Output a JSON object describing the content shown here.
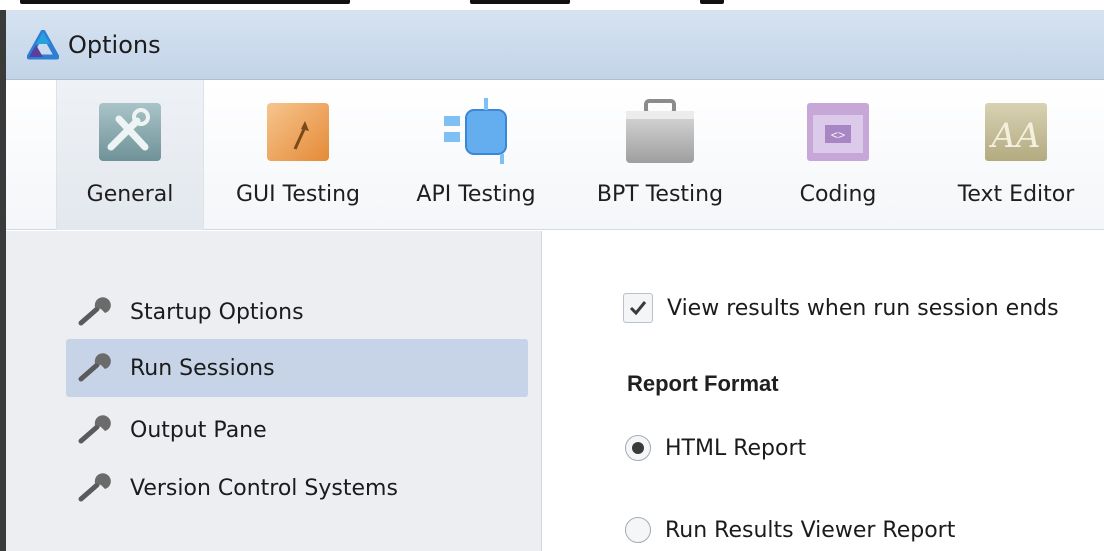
{
  "window": {
    "title": "Options",
    "app_icon": "alm-logo-icon"
  },
  "toolbar": {
    "items": [
      {
        "label": "General",
        "icon": "tools-icon",
        "selected": true
      },
      {
        "label": "GUI Testing",
        "icon": "gui-testing-icon",
        "selected": false
      },
      {
        "label": "API Testing",
        "icon": "api-testing-icon",
        "selected": false
      },
      {
        "label": "BPT Testing",
        "icon": "briefcase-icon",
        "selected": false
      },
      {
        "label": "Coding",
        "icon": "code-window-icon",
        "selected": false
      },
      {
        "label": "Text Editor",
        "icon": "font-icon",
        "selected": false
      }
    ]
  },
  "sidebar": {
    "items": [
      {
        "label": "Startup Options",
        "icon": "wrench-icon",
        "selected": false
      },
      {
        "label": "Run Sessions",
        "icon": "wrench-icon",
        "selected": true
      },
      {
        "label": "Output Pane",
        "icon": "wrench-icon",
        "selected": false
      },
      {
        "label": "Version Control Systems",
        "icon": "wrench-icon",
        "selected": false
      }
    ]
  },
  "run_sessions": {
    "view_results": {
      "label": "View results when run session ends",
      "checked": true
    },
    "report_format": {
      "heading": "Report Format",
      "options": [
        {
          "label": "HTML Report",
          "selected": true
        },
        {
          "label": "Run Results Viewer Report",
          "selected": false
        }
      ]
    }
  },
  "colors": {
    "titlebar": "#c9d8ea",
    "selection": "#c7d4e8",
    "sidebar_bg": "#eceef2"
  }
}
